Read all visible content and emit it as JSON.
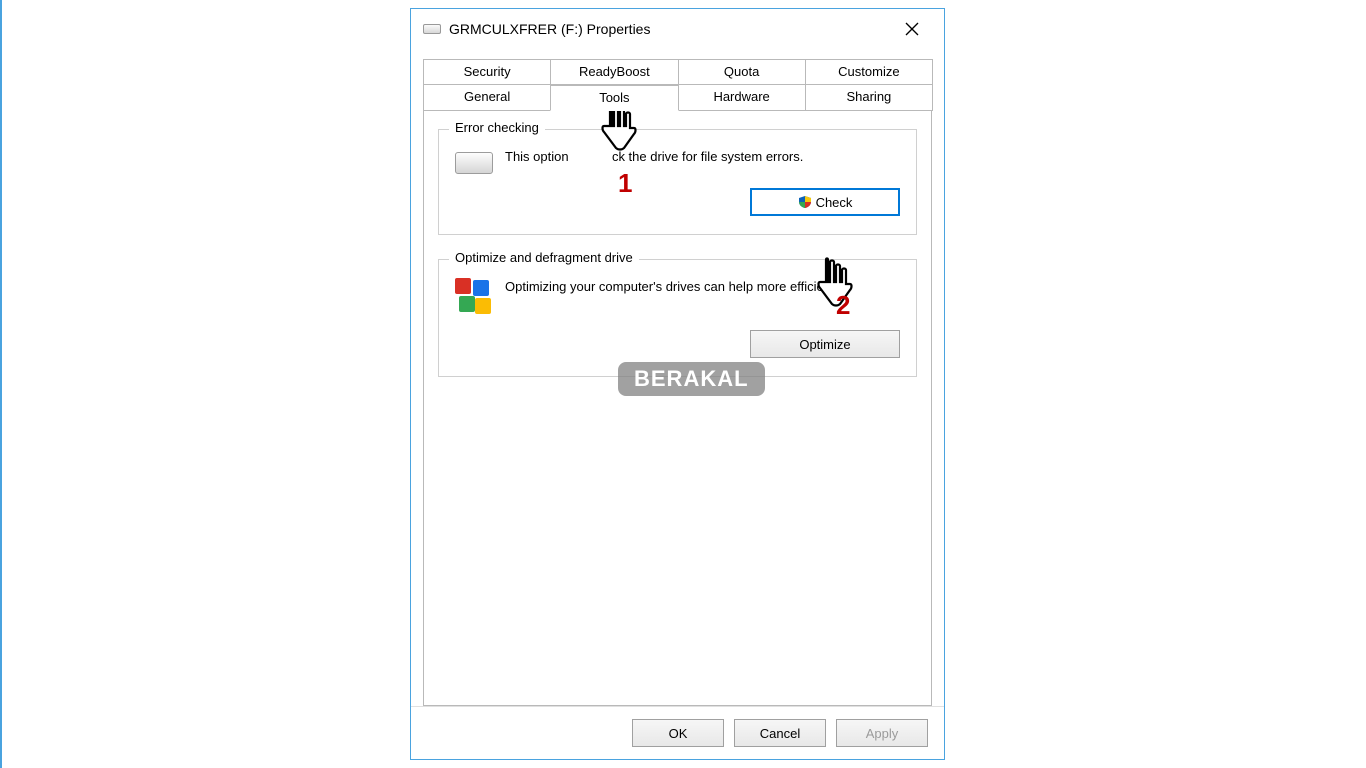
{
  "window": {
    "title": "GRMCULXFRER (F:) Properties"
  },
  "tabs": {
    "row1": [
      "Security",
      "ReadyBoost",
      "Quota",
      "Customize"
    ],
    "row2": [
      "General",
      "Tools",
      "Hardware",
      "Sharing"
    ],
    "active": "Tools"
  },
  "error_checking": {
    "legend": "Error checking",
    "desc_partA": "This option",
    "desc_partB": "ck the drive for file system errors.",
    "button": "Check"
  },
  "optimize": {
    "legend": "Optimize and defragment drive",
    "desc": "Optimizing your computer's drives can help more efficiently.",
    "button": "Optimize"
  },
  "dialog_buttons": {
    "ok": "OK",
    "cancel": "Cancel",
    "apply": "Apply"
  },
  "annotations": {
    "num1": "1",
    "num2": "2"
  },
  "watermark": "BERAKAL"
}
